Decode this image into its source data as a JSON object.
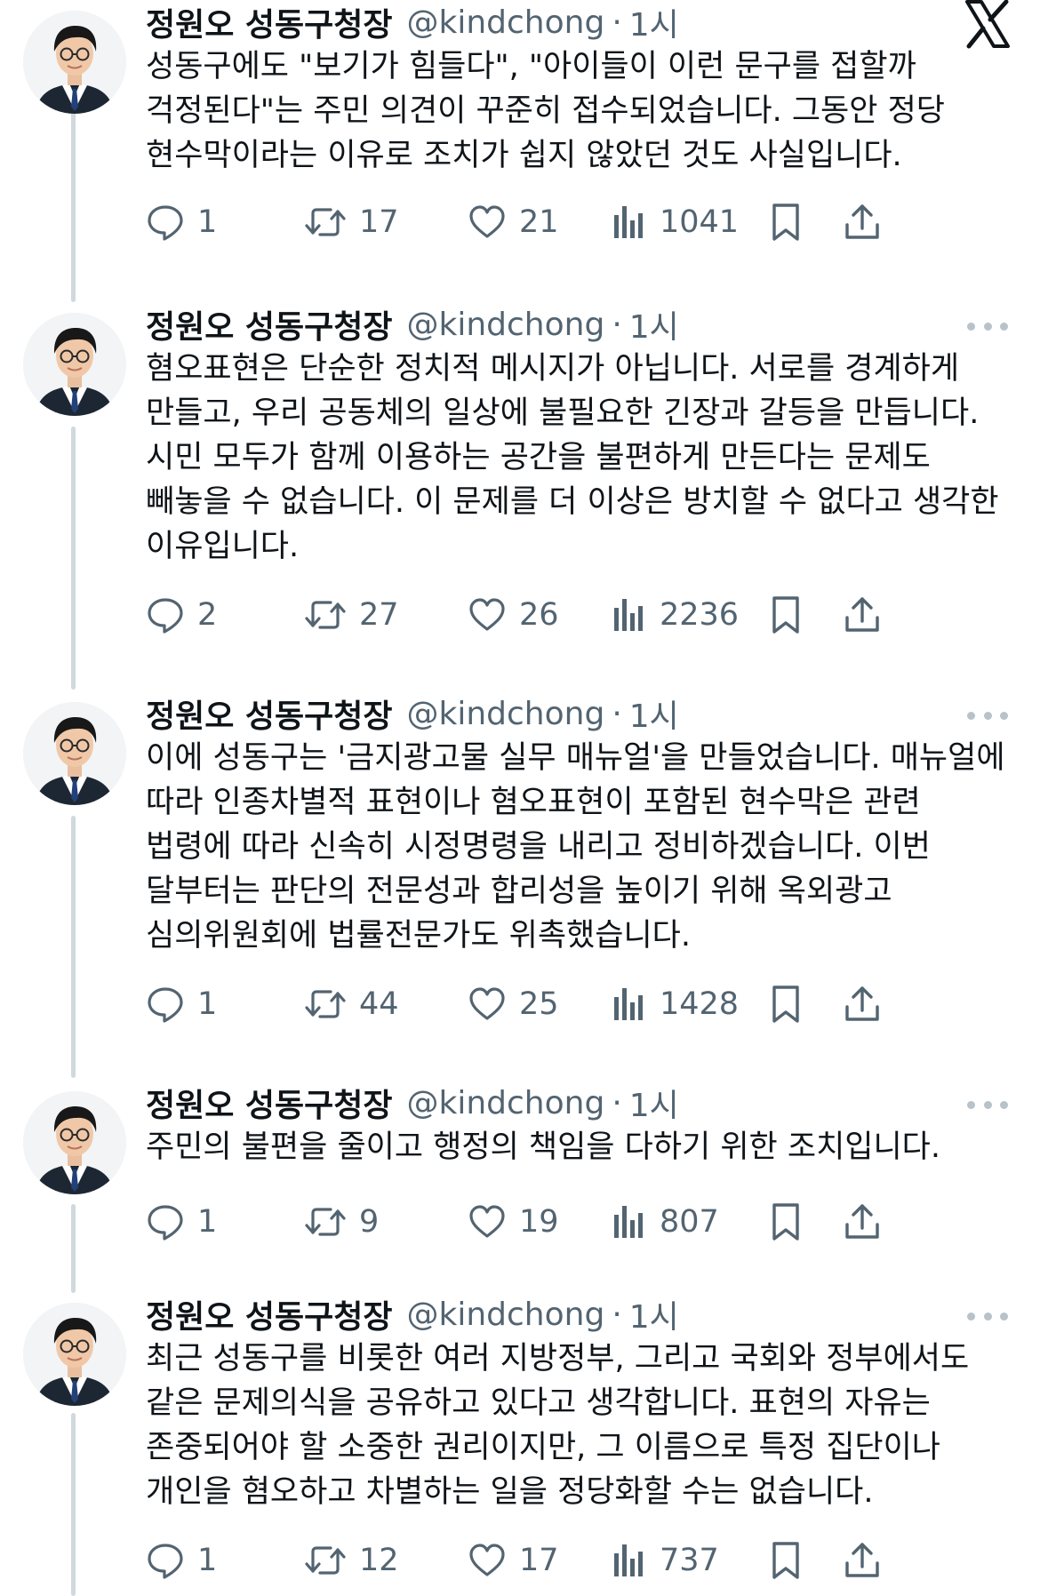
{
  "author": {
    "name": "정원오 성동구청장",
    "handle": "@kindchong",
    "time": "1시",
    "separator": "·"
  },
  "brand": {
    "logo": "x-logo-icon"
  },
  "colors": {
    "text": "#0f1419",
    "muted": "#536471",
    "thread_line": "#cfd9de"
  },
  "icons": {
    "reply": "reply-icon",
    "repost": "repost-icon",
    "like": "heart-icon",
    "views": "views-icon",
    "bookmark": "bookmark-icon",
    "share": "share-icon",
    "more": "more-icon"
  },
  "tweets": [
    {
      "text": "성동구에도 \"보기가 힘들다\", \"아이들이 이런 문구를 접할까 걱정된다\"는 주민 의견이 꾸준히 접수되었습니다. 그동안 정당 현수막이라는 이유로 조치가 쉽지 않았던 것도 사실입니다.",
      "replies": "1",
      "reposts": "17",
      "likes": "21",
      "views": "1041"
    },
    {
      "text": "혐오표현은 단순한 정치적 메시지가 아닙니다. 서로를 경계하게 만들고, 우리 공동체의 일상에 불필요한 긴장과 갈등을 만듭니다. 시민 모두가 함께 이용하는 공간을 불편하게 만든다는 문제도 빼놓을 수 없습니다. 이 문제를 더 이상은 방치할 수 없다고 생각한 이유입니다.",
      "replies": "2",
      "reposts": "27",
      "likes": "26",
      "views": "2236"
    },
    {
      "text": "이에 성동구는 '금지광고물 실무 매뉴얼'을 만들었습니다. 매뉴얼에 따라 인종차별적 표현이나 혐오표현이 포함된 현수막은 관련 법령에 따라 신속히 시정명령을 내리고 정비하겠습니다. 이번 달부터는 판단의 전문성과 합리성을 높이기 위해 옥외광고 심의위원회에 법률전문가도 위촉했습니다.",
      "replies": "1",
      "reposts": "44",
      "likes": "25",
      "views": "1428"
    },
    {
      "text": "주민의 불편을 줄이고 행정의 책임을 다하기 위한 조치입니다.",
      "replies": "1",
      "reposts": "9",
      "likes": "19",
      "views": "807"
    },
    {
      "text": "최근 성동구를 비롯한 여러 지방정부, 그리고 국회와 정부에서도 같은 문제의식을 공유하고 있다고 생각합니다. 표현의 자유는 존중되어야 할 소중한 권리이지만, 그 이름으로 특정 집단이나 개인을 혐오하고 차별하는 일을 정당화할 수는 없습니다.",
      "replies": "1",
      "reposts": "12",
      "likes": "17",
      "views": "737"
    }
  ]
}
